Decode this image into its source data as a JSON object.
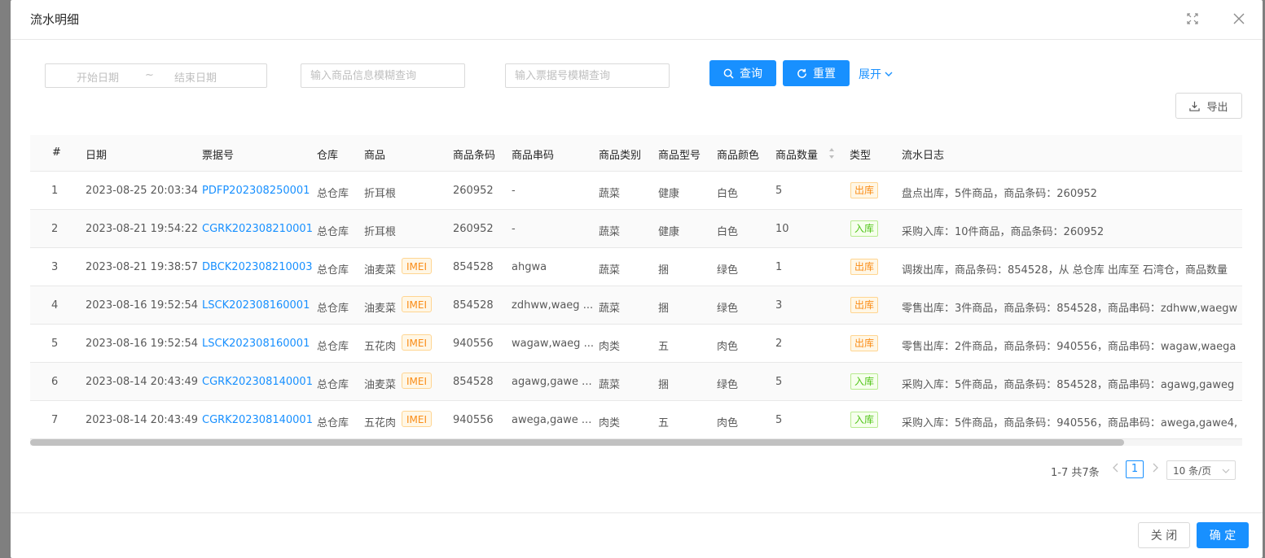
{
  "modal": {
    "title": "流水明细"
  },
  "filters": {
    "start_date_placeholder": "开始日期",
    "range_separator": "~",
    "end_date_placeholder": "结束日期",
    "product_placeholder": "输入商品信息模糊查询",
    "ticket_placeholder": "输入票据号模糊查询",
    "search_label": "查询",
    "reset_label": "重置",
    "expand_label": "展开"
  },
  "toolbar": {
    "export_label": "导出"
  },
  "table": {
    "columns": [
      "#",
      "日期",
      "票据号",
      "仓库",
      "商品",
      "商品条码",
      "商品串码",
      "商品类别",
      "商品型号",
      "商品颜色",
      "商品数量",
      "类型",
      "流水日志"
    ],
    "rows": [
      {
        "idx": "1",
        "date": "2023-08-25 20:03:34",
        "ticket": "PDFP202308250001",
        "warehouse": "总仓库",
        "product": "折耳根",
        "imei": "",
        "barcode": "260952",
        "serial": "-",
        "category": "蔬菜",
        "model": "健康",
        "color": "白色",
        "qty": "5",
        "type": "出库",
        "type_kind": "out",
        "log": "盘点出库，5件商品，商品条码：260952"
      },
      {
        "idx": "2",
        "date": "2023-08-21 19:54:22",
        "ticket": "CGRK202308210001",
        "warehouse": "总仓库",
        "product": "折耳根",
        "imei": "",
        "barcode": "260952",
        "serial": "-",
        "category": "蔬菜",
        "model": "健康",
        "color": "白色",
        "qty": "10",
        "type": "入库",
        "type_kind": "in",
        "log": "采购入库：10件商品，商品条码：260952"
      },
      {
        "idx": "3",
        "date": "2023-08-21 19:38:57",
        "ticket": "DBCK202308210003",
        "warehouse": "总仓库",
        "product": "油麦菜",
        "imei": "IMEI",
        "barcode": "854528",
        "serial": "ahgwa",
        "category": "蔬菜",
        "model": "捆",
        "color": "绿色",
        "qty": "1",
        "type": "出库",
        "type_kind": "out",
        "log": "调拨出库，商品条码：854528，从 总仓库 出库至 石湾仓，商品数量"
      },
      {
        "idx": "4",
        "date": "2023-08-16 19:52:54",
        "ticket": "LSCK202308160001",
        "warehouse": "总仓库",
        "product": "油麦菜",
        "imei": "IMEI",
        "barcode": "854528",
        "serial": "zdhww,waeg ...",
        "category": "蔬菜",
        "model": "捆",
        "color": "绿色",
        "qty": "3",
        "type": "出库",
        "type_kind": "out",
        "log": "零售出库：3件商品，商品条码：854528，商品串码：zdhww,waegw"
      },
      {
        "idx": "5",
        "date": "2023-08-16 19:52:54",
        "ticket": "LSCK202308160001",
        "warehouse": "总仓库",
        "product": "五花肉",
        "imei": "IMEI",
        "barcode": "940556",
        "serial": "wagaw,waeg ...",
        "category": "肉类",
        "model": "五",
        "color": "肉色",
        "qty": "2",
        "type": "出库",
        "type_kind": "out",
        "log": "零售出库：2件商品，商品条码：940556，商品串码：wagaw,waega"
      },
      {
        "idx": "6",
        "date": "2023-08-14 20:43:49",
        "ticket": "CGRK202308140001",
        "warehouse": "总仓库",
        "product": "油麦菜",
        "imei": "IMEI",
        "barcode": "854528",
        "serial": "agawg,gawe ...",
        "category": "蔬菜",
        "model": "捆",
        "color": "绿色",
        "qty": "5",
        "type": "入库",
        "type_kind": "in",
        "log": "采购入库：5件商品，商品条码：854528，商品串码：agawg,gaweg"
      },
      {
        "idx": "7",
        "date": "2023-08-14 20:43:49",
        "ticket": "CGRK202308140001",
        "warehouse": "总仓库",
        "product": "五花肉",
        "imei": "IMEI",
        "barcode": "940556",
        "serial": "awega,gawe ...",
        "category": "肉类",
        "model": "五",
        "color": "肉色",
        "qty": "5",
        "type": "入库",
        "type_kind": "in",
        "log": "采购入库：5件商品，商品条码：940556，商品串码：awega,gawe4,"
      }
    ]
  },
  "pagination": {
    "summary": "1-7 共7条",
    "current_page": "1",
    "page_size": "10 条/页"
  },
  "footer": {
    "close_label": "关 闭",
    "ok_label": "确 定"
  },
  "colors": {
    "primary": "#1890ff",
    "out_tag": "#fa8c16",
    "in_tag": "#52c41a"
  }
}
